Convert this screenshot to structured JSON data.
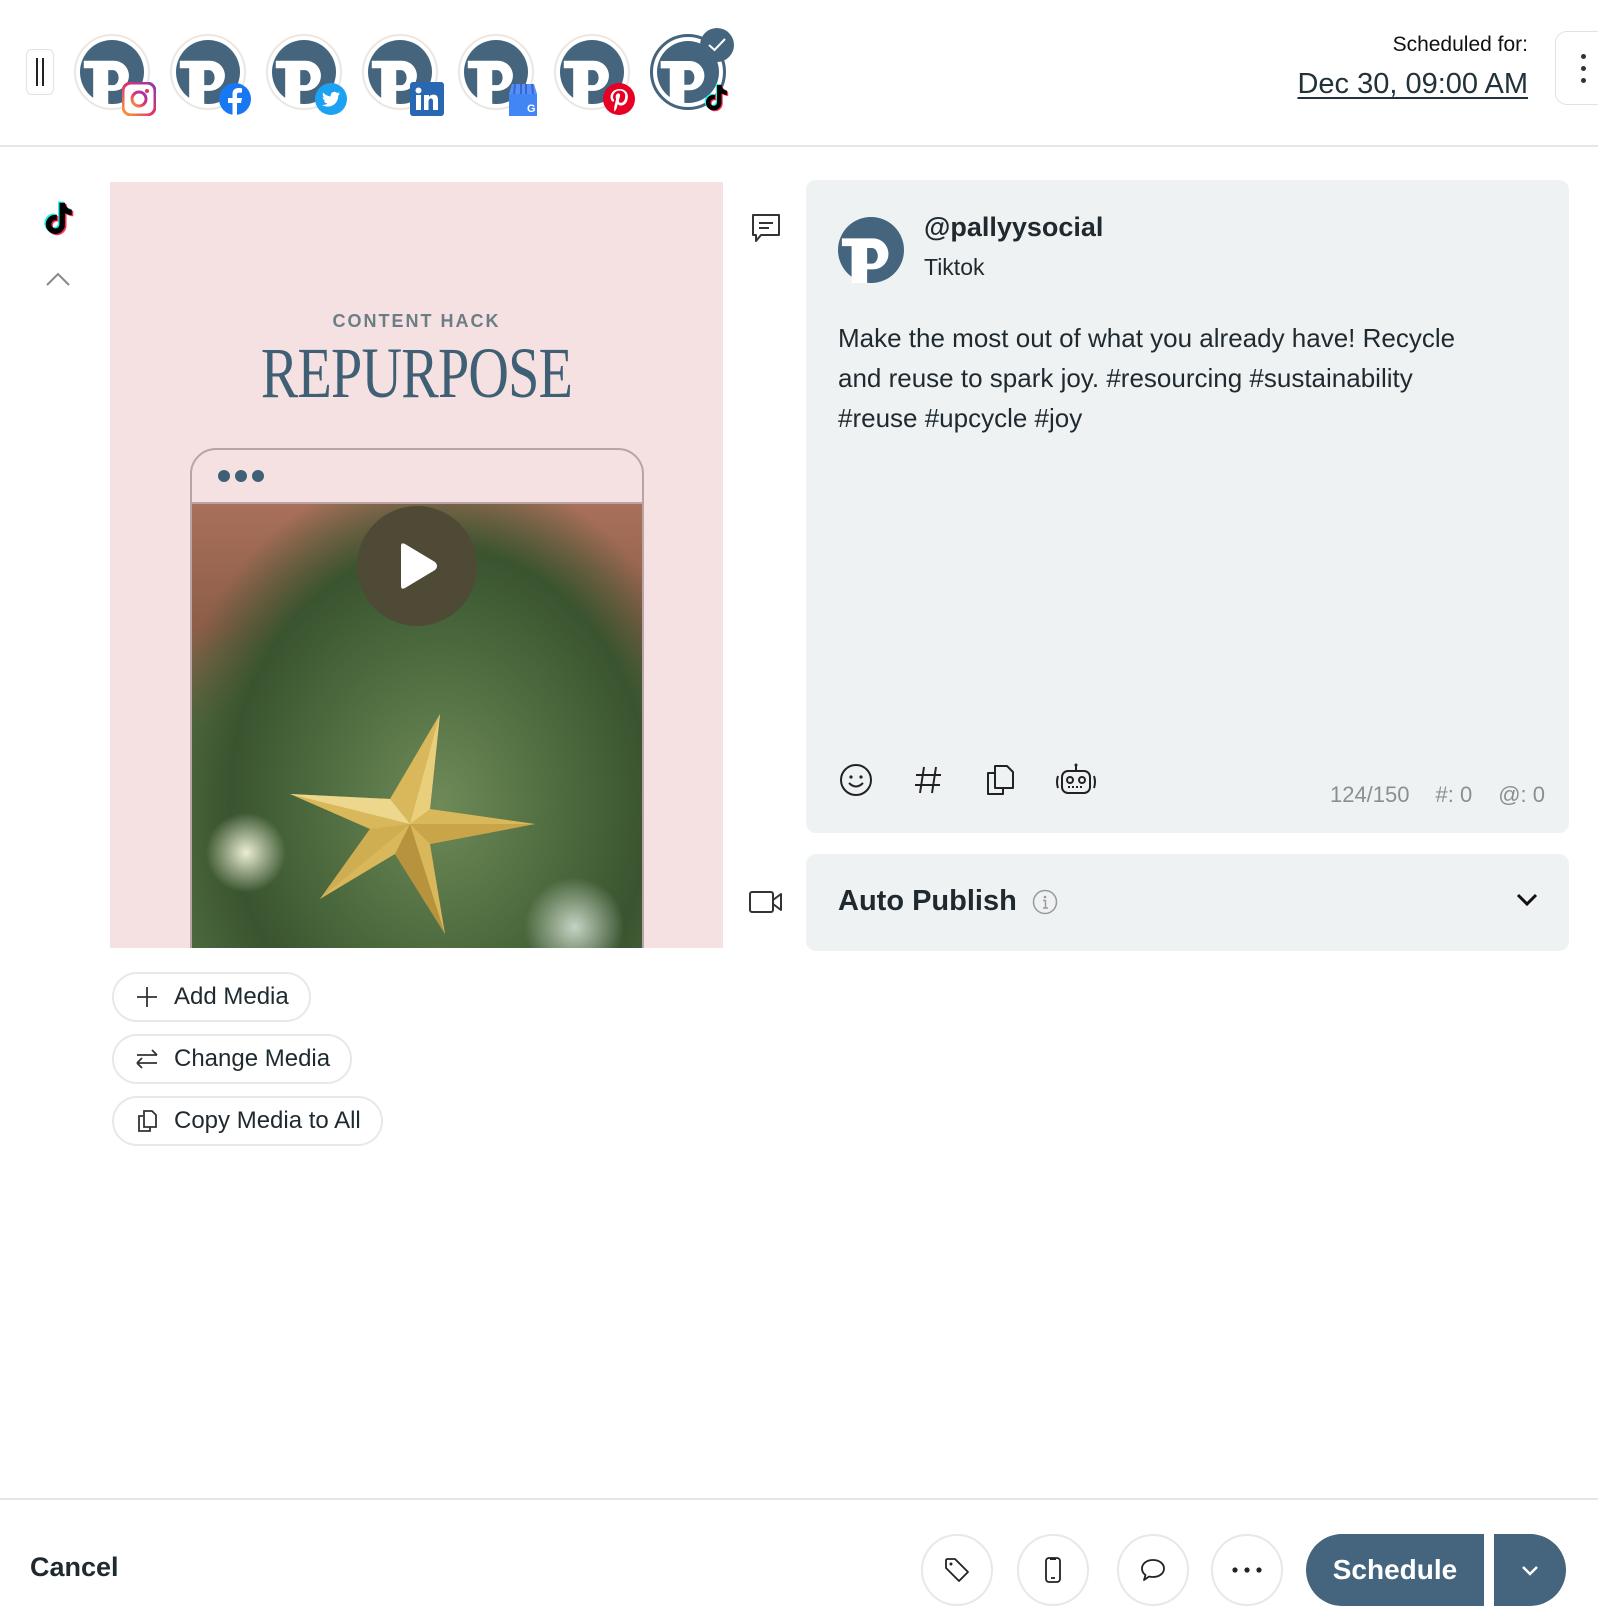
{
  "header": {
    "drag_handle_icon": "drag-handle-icon",
    "accounts": [
      {
        "name": "pallyysocial",
        "network": "Instagram",
        "badge_icon": "instagram-icon",
        "selected": false
      },
      {
        "name": "pallyysocial",
        "network": "Facebook",
        "badge_icon": "facebook-icon",
        "selected": false
      },
      {
        "name": "pallyysocial",
        "network": "Twitter",
        "badge_icon": "twitter-icon",
        "selected": false
      },
      {
        "name": "pallyysocial",
        "network": "LinkedIn",
        "badge_icon": "linkedin-icon",
        "selected": false
      },
      {
        "name": "pallyysocial",
        "network": "Google Business",
        "badge_icon": "google-business-icon",
        "selected": false
      },
      {
        "name": "pallyysocial",
        "network": "Pinterest",
        "badge_icon": "pinterest-icon",
        "selected": false
      },
      {
        "name": "pallyysocial",
        "network": "TikTok",
        "badge_icon": "tiktok-icon",
        "selected": true
      }
    ],
    "scheduled_label": "Scheduled for:",
    "scheduled_date": "Dec 30, 09:00 AM",
    "more_icon": "kebab-menu-icon"
  },
  "rail": {
    "network_icon": "tiktok-icon",
    "collapse_icon": "chevron-up-icon"
  },
  "media": {
    "kicker": "CONTENT HACK",
    "title": "REPURPOSE",
    "play_icon": "play-icon",
    "buttons": [
      {
        "label": "Add Media",
        "icon": "plus-icon"
      },
      {
        "label": "Change Media",
        "icon": "swap-arrows-icon"
      },
      {
        "label": "Copy Media to All",
        "icon": "copy-icon"
      }
    ]
  },
  "post": {
    "caption_icon": "caption-icon",
    "handle": "@pallyysocial",
    "network": "Tiktok",
    "text": "Make the most out of what you already have! Recycle and reuse to spark joy. #resourcing #sustainability #reuse #upcycle #joy",
    "tools": [
      "emoji-icon",
      "hashtag-icon",
      "copy-icon",
      "ai-robot-icon"
    ],
    "char_count": "124/150",
    "hashtag_count": "#: 0",
    "mention_count": "@: 0"
  },
  "auto_publish": {
    "video_icon": "video-icon",
    "title": "Auto Publish",
    "info_icon": "info-icon",
    "expand_icon": "chevron-down-icon"
  },
  "footer": {
    "cancel_label": "Cancel",
    "icon_buttons": [
      "tag-icon",
      "mobile-preview-icon",
      "comment-icon",
      "more-horizontal-icon"
    ],
    "schedule_label": "Schedule",
    "schedule_dropdown_icon": "chevron-down-icon"
  },
  "colors": {
    "brand": "#44657d",
    "card_bg": "#eff2f2",
    "media_bg": "#f6e1e2"
  }
}
